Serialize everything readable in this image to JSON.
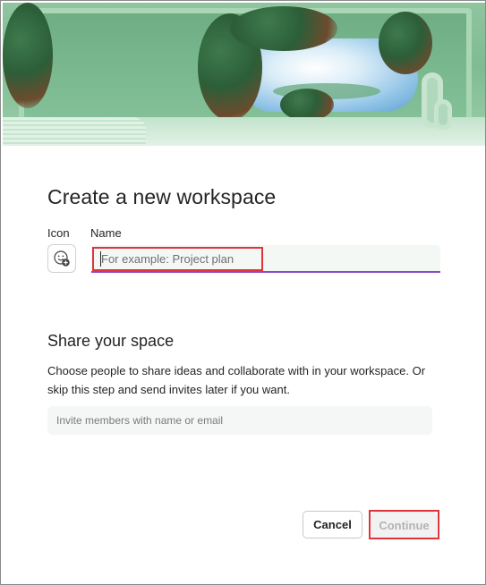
{
  "dialog": {
    "title": "Create a new workspace",
    "icon_label": "Icon",
    "name_label": "Name",
    "name_placeholder": "For example: Project plan",
    "name_value": "",
    "share_title": "Share your space",
    "share_description": "Choose people to share ideas and collaborate with in your workspace. Or skip this step and send invites later if you want.",
    "invite_placeholder": "Invite members with name or email",
    "cancel_label": "Cancel",
    "continue_label": "Continue"
  },
  "icons": {
    "icon_picker": "emoji-add-icon"
  },
  "colors": {
    "focus_underline": "#8d48c8",
    "highlight_box": "#e0343a",
    "banner_green": "#7fbb93"
  }
}
